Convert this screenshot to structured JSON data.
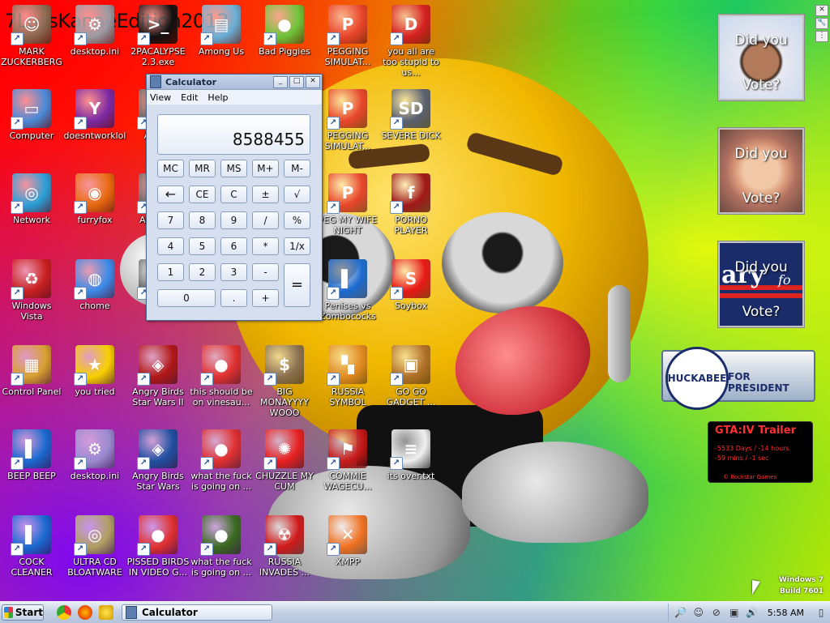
{
  "wallpaper": {
    "title_text": "7LossKanaeEdition2012"
  },
  "desktop_icons": [
    {
      "label": "MARK ZUCKERBERG",
      "icon": "person-icon",
      "color": "#8a6a50"
    },
    {
      "label": "desktop.ini",
      "icon": "settings-file-icon",
      "color": "#9a9aa2"
    },
    {
      "label": "2PACALYPSE 2.3.exe",
      "icon": "console-icon",
      "color": "#111111"
    },
    {
      "label": "Among Us",
      "icon": "folder-stack-icon",
      "color": "#6ab0d8"
    },
    {
      "label": "Bad Piggies",
      "icon": "green-pig-icon",
      "color": "#6fc43a"
    },
    {
      "label": "PEGGING SIMULAT...",
      "icon": "p-logo-icon",
      "color": "#e8452a"
    },
    {
      "label": "you all are too stupid to us...",
      "icon": "dev-cpp-icon",
      "color": "#d62020"
    },
    {
      "label": "Computer",
      "icon": "computer-icon",
      "color": "#4a8ad8"
    },
    {
      "label": "doesntworklol",
      "icon": "yahoo-messenger-icon",
      "color": "#7b2aa5"
    },
    {
      "label": "ANG...",
      "icon": "app-icon",
      "color": "#6a6a6a"
    },
    {
      "label": "PEGGING SIMULAT...",
      "icon": "p-logo-icon",
      "color": "#e8452a"
    },
    {
      "label": "SEVERE DICK",
      "icon": "sd-gear-icon",
      "color": "#5a6070"
    },
    {
      "label": "Network",
      "icon": "network-icon",
      "color": "#2aa0d8"
    },
    {
      "label": "furryfox",
      "icon": "firefox-icon",
      "color": "#e86a10"
    },
    {
      "label": "An... S...",
      "icon": "app-icon",
      "color": "#6a6a6a"
    },
    {
      "label": "PEG MY WIFE NIGHT",
      "icon": "p-logo-icon",
      "color": "#e8452a"
    },
    {
      "label": "PORNO PLAYER",
      "icon": "flash-icon",
      "color": "#a01818"
    },
    {
      "label": "Windows Vista",
      "icon": "recycle-bin-icon",
      "color": "#c82020"
    },
    {
      "label": "chome",
      "icon": "chrome-icon",
      "color": "#3a8ae8"
    },
    {
      "label": "An...",
      "icon": "app-icon",
      "color": "#6a6a6a"
    },
    {
      "label": "Penises vs Zombococks",
      "icon": "blue-book-icon",
      "color": "#1a6ad0"
    },
    {
      "label": "Soybox",
      "icon": "s-logo-icon",
      "color": "#e81818"
    },
    {
      "label": "Control Panel",
      "icon": "control-panel-icon",
      "color": "#d8a030"
    },
    {
      "label": "you tried",
      "icon": "star-icon",
      "color": "#f8d000"
    },
    {
      "label": "Angry Birds Star Wars II",
      "icon": "angry-birds-sw2-icon",
      "color": "#b01818"
    },
    {
      "label": "this should be on vinesau...",
      "icon": "angry-bird-icon",
      "color": "#e03030"
    },
    {
      "label": "BIG MONAYYYY WOOO",
      "icon": "money-bag-icon",
      "color": "#8a7050"
    },
    {
      "label": "RUSSIA SYMBOL",
      "icon": "blocks-icon",
      "color": "#e08a20"
    },
    {
      "label": "GO GO GADGET ...",
      "icon": "briefcase-icon",
      "color": "#b07028"
    },
    {
      "label": "BEEP BEEP",
      "icon": "blue-book-icon",
      "color": "#1a6ad0"
    },
    {
      "label": "desktop.ini",
      "icon": "settings-file-icon",
      "color": "#9a8ad0"
    },
    {
      "label": "Angry Birds Star Wars",
      "icon": "angry-birds-sw-icon",
      "color": "#2050a0"
    },
    {
      "label": "what the fuck is going on ...",
      "icon": "angry-bird-icon",
      "color": "#e03030"
    },
    {
      "label": "CHUZZLE MY CUM",
      "icon": "chuzzle-icon",
      "color": "#e82020"
    },
    {
      "label": "COMMIE WAGECU...",
      "icon": "flag-icon",
      "color": "#c81818"
    },
    {
      "label": "its over.txt",
      "icon": "text-file-icon",
      "color": "#f0f0f0"
    },
    {
      "label": "COCK CLEANER",
      "icon": "blue-book-icon",
      "color": "#1a6ad0"
    },
    {
      "label": "ULTRA CD BLOATWARE",
      "icon": "cd-icon",
      "color": "#b0a060"
    },
    {
      "label": "PISSED BIRDS IN VIDEO G...",
      "icon": "angry-bird-icon",
      "color": "#e03030"
    },
    {
      "label": "what the fuck is going on ...",
      "icon": "angry-bird-space-icon",
      "color": "#3a6a20"
    },
    {
      "label": "RUSSIA INVADES ...",
      "icon": "radiation-icon",
      "color": "#d01818"
    },
    {
      "label": "XMPP",
      "icon": "xampp-icon",
      "color": "#f07020"
    }
  ],
  "calculator": {
    "title": "Calculator",
    "menu": [
      "View",
      "Edit",
      "Help"
    ],
    "display": "8588455",
    "buttons": {
      "mc": "MC",
      "mr": "MR",
      "ms": "MS",
      "mplus": "M+",
      "mminus": "M-",
      "back": "←",
      "ce": "CE",
      "c": "C",
      "plusminus": "±",
      "sqrt": "√",
      "n7": "7",
      "n8": "8",
      "n9": "9",
      "div": "/",
      "pct": "%",
      "n4": "4",
      "n5": "5",
      "n6": "6",
      "mul": "*",
      "recip": "1/x",
      "n1": "1",
      "n2": "2",
      "n3": "3",
      "sub": "-",
      "eq": "=",
      "n0": "0",
      "dot": ".",
      "add": "+"
    },
    "window_controls": {
      "minimize": "_",
      "maximize": "□",
      "close": "✕"
    }
  },
  "gadgets": {
    "vote1": {
      "line1": "Did you",
      "line2": "Vote?"
    },
    "vote2": {
      "line1": "Did you",
      "line2": "Vote?"
    },
    "vote3": {
      "line1": "Did you",
      "line2": "Vote?",
      "banner_word": "ary",
      "banner_suffix": "fo"
    },
    "huckabee": {
      "name": "HUCKABEE",
      "slogan": "FOR PRESIDENT"
    },
    "gta": {
      "title": "GTA:IV Trailer",
      "countdown_1": "-5533 Days / -14 hours",
      "countdown_2": "-59 mins / -1 sec",
      "credit": "© Rockstar Games"
    }
  },
  "watermark": {
    "line1": "Windows 7",
    "line2": "Build 7601"
  },
  "taskbar": {
    "start_label": "Start",
    "active_window": "Calculator",
    "clock": "5:58 AM",
    "tray_icons": [
      "search-icon",
      "smiley-icon",
      "blocked-icon",
      "network-icon",
      "speaker-icon",
      "power-icon"
    ]
  }
}
